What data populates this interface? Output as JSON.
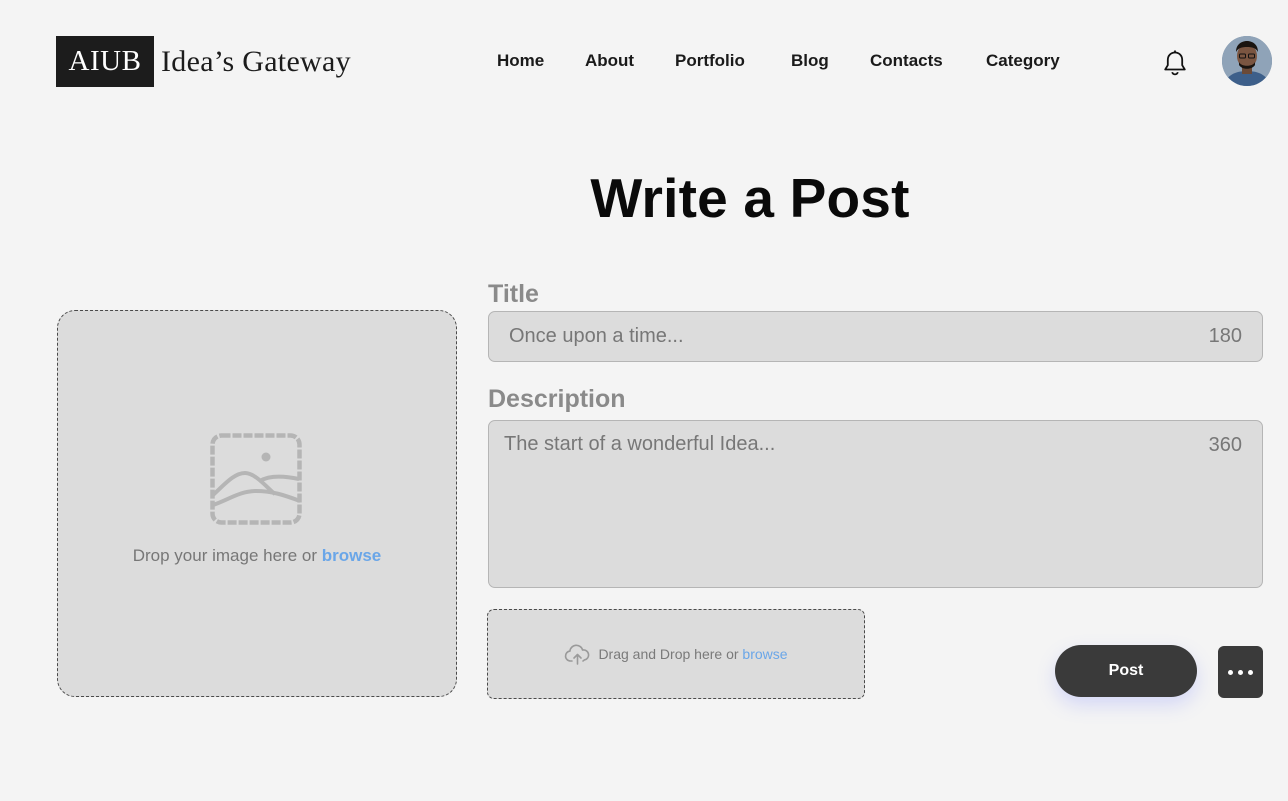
{
  "header": {
    "logo_box": "AIUB",
    "logo_text": "Idea’s Gateway",
    "nav": [
      {
        "label": "Home"
      },
      {
        "label": "About"
      },
      {
        "label": "Portfolio"
      },
      {
        "label": "Blog"
      },
      {
        "label": "Contacts"
      },
      {
        "label": "Category"
      }
    ],
    "icons": {
      "notifications": "bell-icon",
      "profile": "avatar"
    }
  },
  "main": {
    "title": "Write a Post",
    "image_drop": {
      "icon": "image-icon",
      "text": "Drop your image here or ",
      "browse": "browse"
    },
    "form": {
      "title_label": "Title",
      "title_placeholder": "Once upon a time...",
      "title_counter": "180",
      "description_label": "Description",
      "description_placeholder": "The start of a wonderful Idea...",
      "description_counter": "360"
    },
    "file_drop": {
      "icon": "cloud-upload-icon",
      "text": "Drag and Drop here or ",
      "browse": "browse"
    },
    "actions": {
      "post_label": "Post",
      "more_icon": "more-horizontal-icon"
    }
  },
  "colors": {
    "background": "#f4f4f4",
    "panel": "#dcdcdc",
    "button": "#3a3a3a",
    "link": "#6aa6e8",
    "label": "#8a8a8a"
  }
}
